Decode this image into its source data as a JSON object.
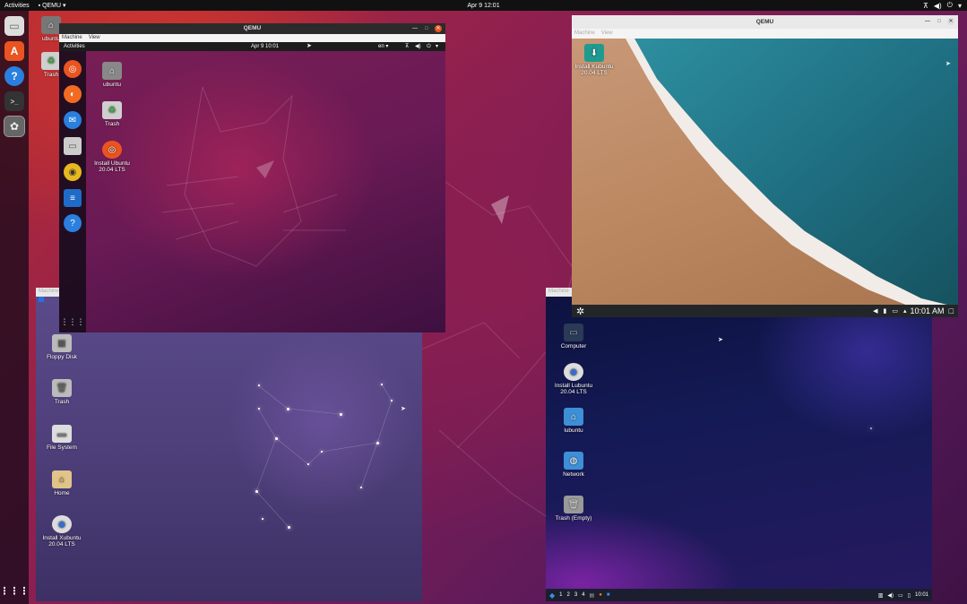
{
  "host": {
    "activities": "Activities",
    "app_menu": "QEMU",
    "clock": "Apr 9  12:01",
    "desktop_icons": [
      {
        "label": "ubuntu"
      },
      {
        "label": "Trash"
      }
    ]
  },
  "ubuntu_window": {
    "title": "QEMU",
    "menu": [
      "Machine",
      "View"
    ],
    "guest_activities": "Activities",
    "guest_clock": "Apr 9  10:01",
    "guest_lang": "en",
    "desktop_icons": [
      {
        "label": "ubuntu"
      },
      {
        "label": "Trash"
      },
      {
        "label": "Install Ubuntu\n20.04 LTS"
      }
    ]
  },
  "kubuntu_window": {
    "title": "QEMU",
    "menu": [
      "Machine",
      "View"
    ],
    "desktop_icons": [
      {
        "label": "Install Kubuntu\n20.04 LTS"
      }
    ],
    "clock": "10:01 AM"
  },
  "xubuntu_window": {
    "menu_fragment": "Machine",
    "desktop_icons": [
      {
        "label": "Floppy Disk"
      },
      {
        "label": "Trash"
      },
      {
        "label": "File System"
      },
      {
        "label": "Home"
      },
      {
        "label": "Install Xubuntu\n20.04 LTS"
      }
    ]
  },
  "lubuntu_window": {
    "menu_fragment": "Machine",
    "desktop_icons": [
      {
        "label": "Computer"
      },
      {
        "label": "Install Lubuntu\n20.04 LTS"
      },
      {
        "label": "lubuntu"
      },
      {
        "label": "Network"
      },
      {
        "label": "Trash (Empty)"
      }
    ],
    "workspaces": [
      "1",
      "2",
      "3",
      "4"
    ],
    "clock": "10:01"
  },
  "colors": {
    "ubuntu_orange": "#e95420",
    "kde_blue": "#3daee9",
    "lubuntu_folder": "#3d8fd6"
  }
}
